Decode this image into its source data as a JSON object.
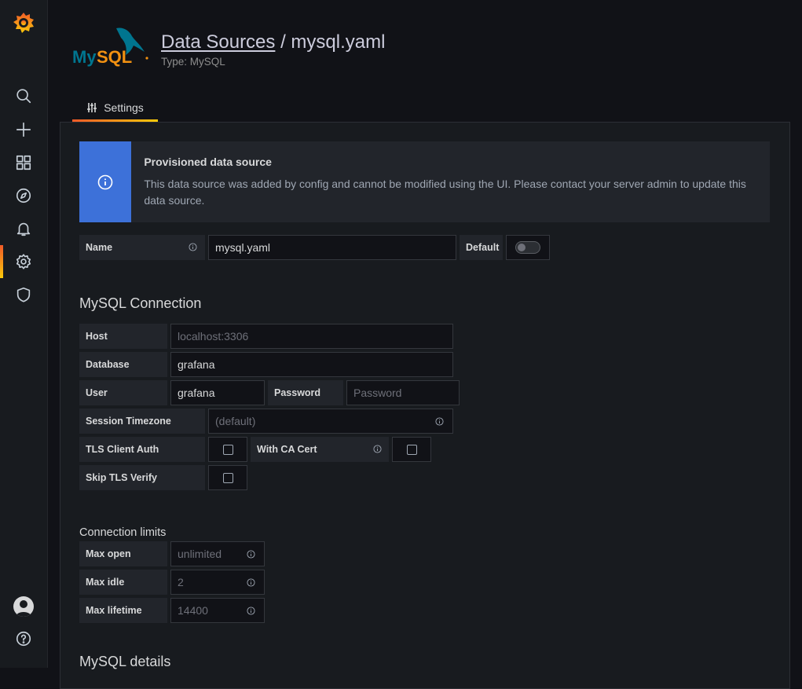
{
  "sidebar": {
    "items": [
      {
        "name": "search-icon"
      },
      {
        "name": "plus-icon"
      },
      {
        "name": "dashboards-icon"
      },
      {
        "name": "explore-icon"
      },
      {
        "name": "alerting-icon"
      },
      {
        "name": "configuration-icon"
      },
      {
        "name": "shield-icon"
      }
    ],
    "accent": "#f05a28"
  },
  "header": {
    "breadcrumb_link": "Data Sources",
    "separator": " / ",
    "title": "mysql.yaml",
    "subtitle": "Type: MySQL"
  },
  "tabs": [
    {
      "label": "Settings"
    }
  ],
  "alert": {
    "title": "Provisioned data source",
    "text": "This data source was added by config and cannot be modified using the UI. Please contact your server admin to update this data source.",
    "color": "#3d71d9"
  },
  "name_row": {
    "label": "Name",
    "value": "mysql.yaml",
    "default_label": "Default"
  },
  "connection": {
    "heading": "MySQL Connection",
    "host_label": "Host",
    "host_placeholder": "localhost:3306",
    "database_label": "Database",
    "database_value": "grafana",
    "user_label": "User",
    "user_value": "grafana",
    "password_label": "Password",
    "password_placeholder": "Password",
    "timezone_label": "Session Timezone",
    "timezone_placeholder": "(default)",
    "tls_client_auth_label": "TLS Client Auth",
    "with_ca_cert_label": "With CA Cert",
    "skip_tls_label": "Skip TLS Verify"
  },
  "limits": {
    "heading": "Connection limits",
    "max_open_label": "Max open",
    "max_open_placeholder": "unlimited",
    "max_idle_label": "Max idle",
    "max_idle_placeholder": "2",
    "max_lifetime_label": "Max lifetime",
    "max_lifetime_placeholder": "14400"
  },
  "details": {
    "heading": "MySQL details"
  }
}
